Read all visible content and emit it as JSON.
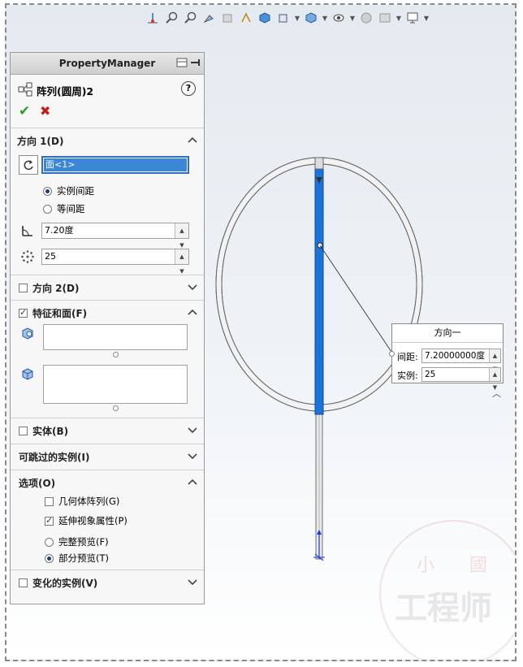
{
  "property_manager": {
    "header": "PropertyManager",
    "feature_title": "阵列(圆周)2",
    "help_label": "?",
    "ok_label": "✔",
    "cancel_label": "✖"
  },
  "direction1": {
    "label": "方向 1(D)",
    "selection": "面<1>",
    "option_instance_spacing": "实例间距",
    "option_equal_spacing": "等间距",
    "angle": "7.20度",
    "count": "25"
  },
  "direction2": {
    "label": "方向 2(D)"
  },
  "features_faces": {
    "label": "特征和面(F)"
  },
  "bodies": {
    "label": "实体(B)"
  },
  "skip_instances": {
    "label": "可跳过的实例(I)"
  },
  "options": {
    "label": "选项(O)",
    "geometry_pattern": "几何体阵列(G)",
    "propagate_visual": "延伸视象属性(P)",
    "full_preview": "完整预览(F)",
    "partial_preview": "部分预览(T)"
  },
  "varied_instances": {
    "label": "变化的实例(V)"
  },
  "callout": {
    "title": "方向一",
    "spacing_label": "间距:",
    "spacing_value": "7.20000000度",
    "instances_label": "实例:",
    "instances_value": "25"
  },
  "watermark": {
    "top": "小 國",
    "bottom": "工程师"
  },
  "colors": {
    "accent": "#1b72d8",
    "selection_bg": "#3b86d6",
    "ok": "#2e9b2e",
    "cancel": "#c0201a"
  }
}
